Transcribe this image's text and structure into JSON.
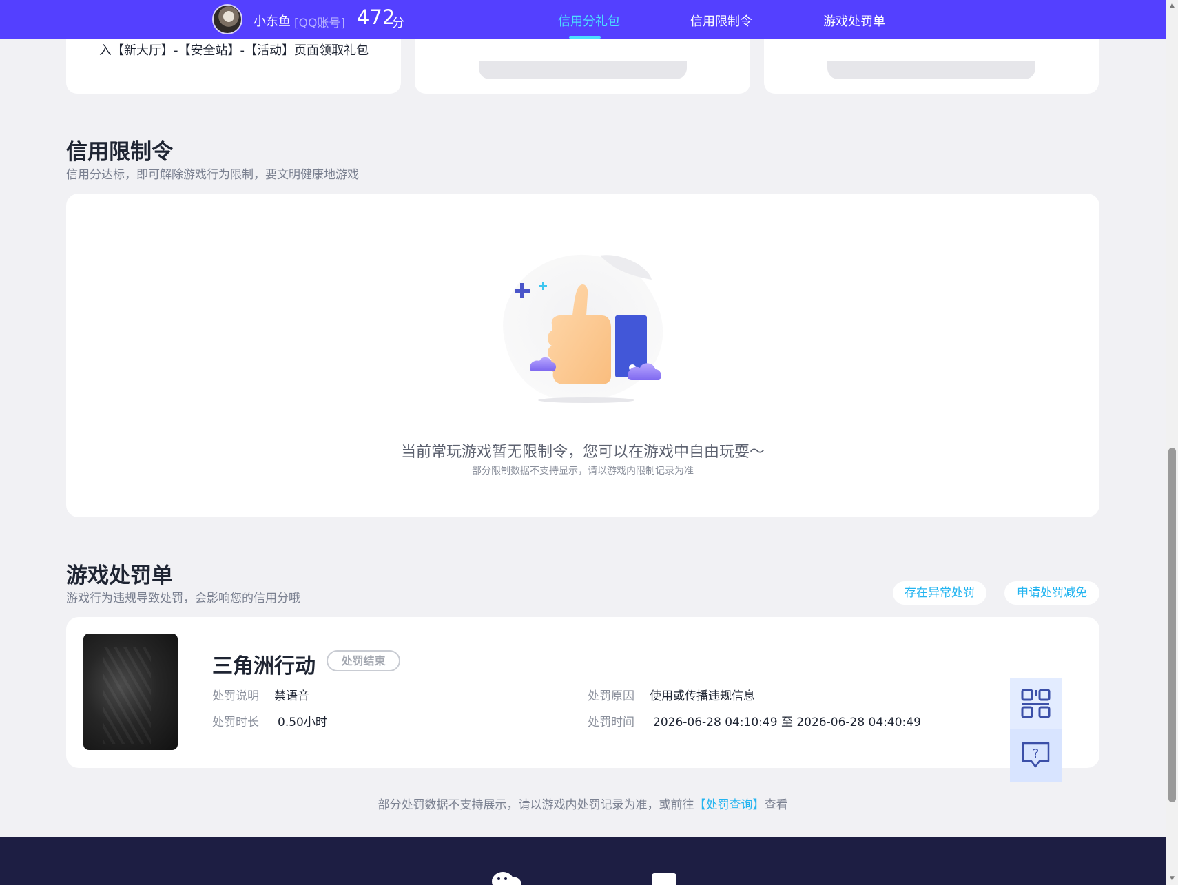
{
  "header": {
    "username": "小东鱼",
    "account_type": "[QQ账号]",
    "score": "472",
    "score_unit": "分",
    "nav": [
      {
        "label": "信用分礼包",
        "active": true
      },
      {
        "label": "信用限制令",
        "active": false
      },
      {
        "label": "游戏处罚单",
        "active": false
      }
    ]
  },
  "top_cards": {
    "text": "入【新大厅】-【安全站】-【活动】页面领取礼包"
  },
  "restriction": {
    "title": "信用限制令",
    "subtitle": "信用分达标，即可解除游戏行为限制，要文明健康地游戏",
    "empty_title": "当前常玩游戏暂无限制令，您可以在游戏中自由玩耍～",
    "empty_note": "部分限制数据不支持显示，请以游戏内限制记录为准"
  },
  "punishment": {
    "title": "游戏处罚单",
    "subtitle": "游戏行为违规导致处罚，会影响您的信用分哦",
    "btn_abnormal": "存在异常处罚",
    "btn_reduce": "申请处罚减免",
    "record": {
      "game": "三角洲行动",
      "status": "处罚结束",
      "desc_label": "处罚说明",
      "desc_value": "禁语音",
      "duration_label": "处罚时长",
      "duration_value": "0.50小时",
      "reason_label": "处罚原因",
      "reason_value": "使用或传播违规信息",
      "time_label": "处罚时间",
      "time_value": "2026-06-28 04:10:49 至 2026-06-28 04:40:49"
    },
    "footer_note_prefix": "部分处罚数据不支持展示，请以游戏内处罚记录为准，或前往",
    "footer_link": "【处罚查询】",
    "footer_note_suffix": "查看"
  },
  "colors": {
    "header_bg": "#5440ff",
    "accent": "#4be0ff",
    "link": "#23b4f0",
    "footer_bg": "#1d1e43"
  }
}
